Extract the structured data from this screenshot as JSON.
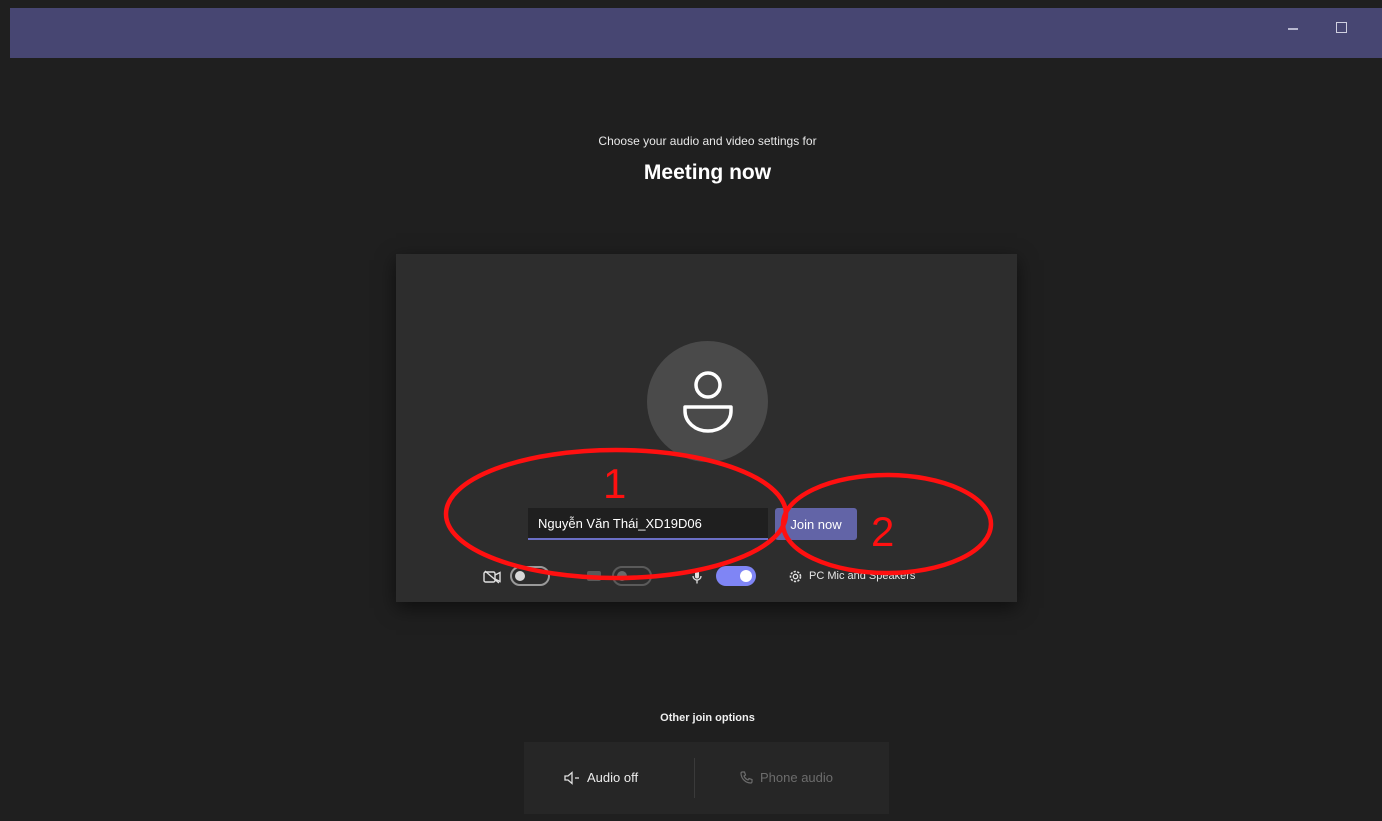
{
  "window": {
    "minimize_label": "",
    "maximize_label": "",
    "close_label": "✕"
  },
  "prejoin": {
    "subtitle": "Choose your audio and video settings for",
    "meeting_title": "Meeting now",
    "name_value": "Nguyễn Văn Thái_XD19D06",
    "join_label": "Join now"
  },
  "controls": {
    "camera_on": false,
    "blur_on": false,
    "mic_on": true,
    "device_label": "PC Mic and Speakers"
  },
  "other": {
    "heading": "Other join options",
    "audio_off_label": "Audio off",
    "phone_audio_label": "Phone audio"
  },
  "annotations": {
    "marker_1": "1",
    "marker_2": "2",
    "color": "#ff1010"
  },
  "colors": {
    "titlebar": "#474672",
    "accent": "#6264a7",
    "toggle_on": "#7f85f5",
    "background": "#1f1f1f"
  }
}
